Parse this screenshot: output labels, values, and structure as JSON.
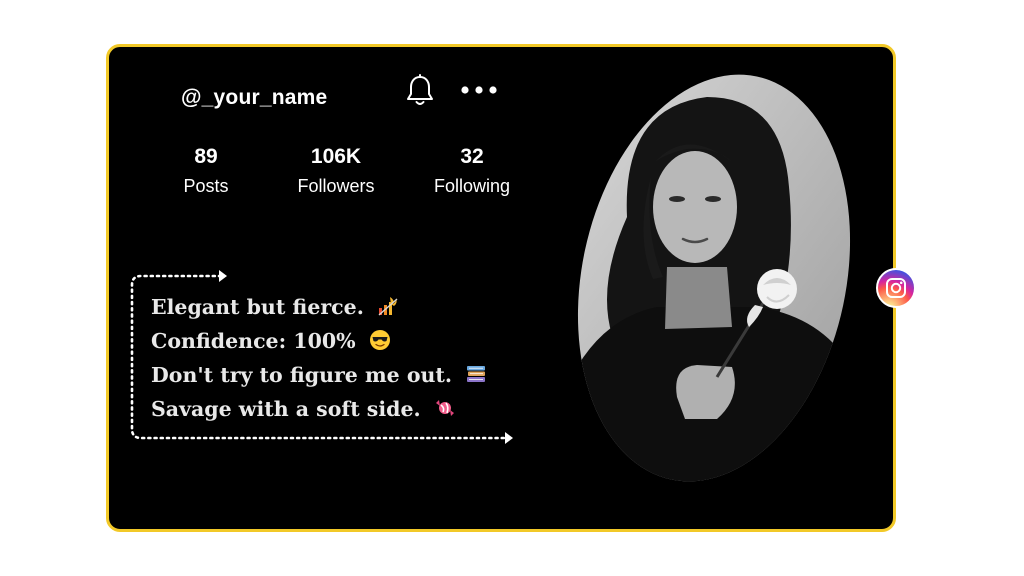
{
  "profile": {
    "handle": "@_your_name"
  },
  "stats": [
    {
      "value": "89",
      "label": "Posts"
    },
    {
      "value": "106K",
      "label": "Followers"
    },
    {
      "value": "32",
      "label": "Following"
    }
  ],
  "bio": [
    {
      "text": "Elegant but fierce.",
      "emoji": "fire-graph-icon"
    },
    {
      "text": "Confidence: 100%",
      "emoji": "sunglasses-face-icon"
    },
    {
      "text": "Don't try to figure me out.",
      "emoji": "books-icon"
    },
    {
      "text": "Savage with a soft side.",
      "emoji": "candy-icon"
    }
  ],
  "icons": {
    "notifications": "bell-icon",
    "options": "more-dots-icon",
    "social": "instagram-icon"
  },
  "colors": {
    "card_background": "#000000",
    "card_border": "#f2c928",
    "text": "#ffffff"
  }
}
